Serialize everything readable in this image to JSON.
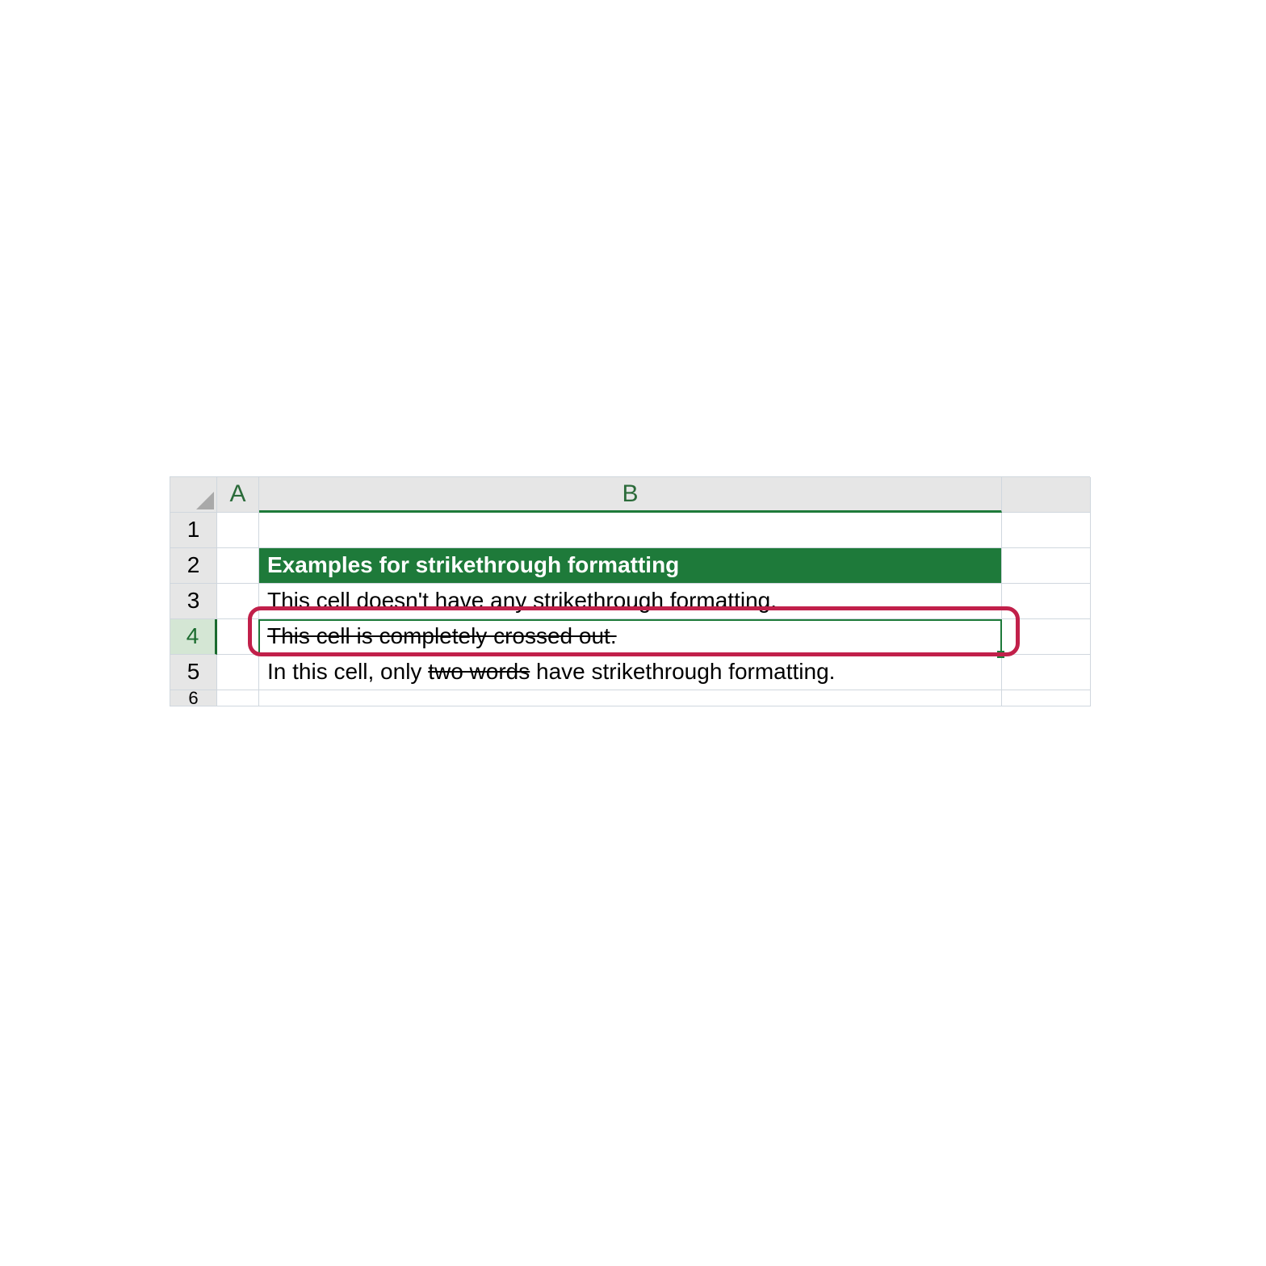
{
  "columns": {
    "corner": "",
    "a": "A",
    "b": "B",
    "c": ""
  },
  "rows": {
    "r1": {
      "num": "1",
      "a": "",
      "b": "",
      "c": ""
    },
    "r2": {
      "num": "2",
      "a": "",
      "b": "Examples for strikethrough formatting",
      "c": ""
    },
    "r3": {
      "num": "3",
      "a": "",
      "b": "This cell doesn't have any strikethrough formatting.",
      "c": ""
    },
    "r4": {
      "num": "4",
      "a": "",
      "b": "This cell is completely crossed out.",
      "c": ""
    },
    "r5": {
      "num": "5",
      "a": "",
      "c": "",
      "b_pre": "In this cell, only ",
      "b_mid": "two words",
      "b_post": " have strikethrough formatting."
    },
    "r6": {
      "num": "6",
      "a": "",
      "b": "",
      "c": ""
    }
  },
  "selected_cell": "B4",
  "colors": {
    "header_fill": "#1e7a3a",
    "selection_border": "#1e7a3a",
    "annotation": "#c1204a",
    "grid": "#d0d7de"
  }
}
